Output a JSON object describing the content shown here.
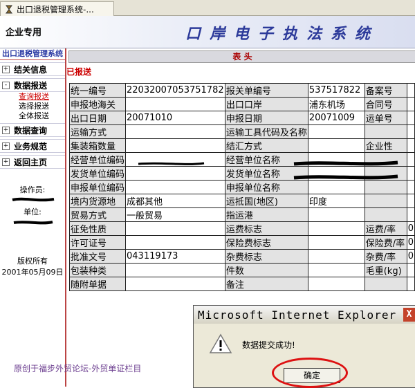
{
  "browser": {
    "tab_title": "出口退税管理系统-...",
    "accent": "#2c3a9a"
  },
  "header": {
    "brand": "企业专用",
    "system_name": "口岸电子执法系统"
  },
  "nav": {
    "title": "出口退税管理系统",
    "groups": [
      {
        "label": "结关信息",
        "toggle": "+"
      },
      {
        "label": "数据报送",
        "toggle": "-"
      },
      {
        "label": "数据查询",
        "toggle": "+"
      },
      {
        "label": "业务规范",
        "toggle": "+"
      },
      {
        "label": "返回主页",
        "toggle": "+"
      }
    ],
    "subitems": [
      "查询报送",
      "选择报送",
      "全体报送"
    ],
    "operator_label": "操作员:",
    "unit_label": "单位:",
    "copyright": "版权所有",
    "copyright_date": "2001年05月09日"
  },
  "content": {
    "section_header": "表 头",
    "status": "已报送"
  },
  "form_rows": [
    [
      "统一编号",
      "22032007053751782",
      "报关单编号",
      "537517822",
      "备案号",
      ""
    ],
    [
      "申报地海关",
      "",
      "出口口岸",
      "浦东机场",
      "合同号",
      ""
    ],
    [
      "出口日期",
      "20071010",
      "申报日期",
      "20071009",
      "运单号",
      ""
    ],
    [
      "运输方式",
      "",
      "运输工具代码及名称",
      "",
      "",
      ""
    ],
    [
      "集装箱数量",
      "",
      "结汇方式",
      "",
      "企业性",
      ""
    ],
    [
      "经营单位编码",
      "",
      "经营单位名称",
      "",
      "",
      ""
    ],
    [
      "发货单位编码",
      "",
      "发货单位名称",
      "",
      "",
      ""
    ],
    [
      "申报单位编码",
      "",
      "申报单位名称",
      "",
      "",
      ""
    ],
    [
      "境内货源地",
      "成都其他",
      "运抵国(地区)",
      "印度",
      "",
      ""
    ],
    [
      "贸易方式",
      "一般贸易",
      "指运港",
      "",
      "",
      ""
    ],
    [
      "征免性质",
      "",
      "运费标志",
      "",
      "运费/率",
      "0"
    ],
    [
      "许可证号",
      "",
      "保险费标志",
      "",
      "保险费/率",
      "0"
    ],
    [
      "批准文号",
      "043119173",
      "杂费标志",
      "",
      "杂费/率",
      "0"
    ],
    [
      "包装种类",
      "",
      "件数",
      "",
      "毛重(kg)",
      ""
    ],
    [
      "随附单据",
      "",
      "备注",
      "",
      "",
      ""
    ]
  ],
  "dialog": {
    "title": "Microsoft Internet Explorer",
    "message": "数据提交成功!",
    "ok_label": "确定",
    "close_glyph": "X"
  },
  "credit": "原创于福步外贸论坛-外贸单证栏目"
}
